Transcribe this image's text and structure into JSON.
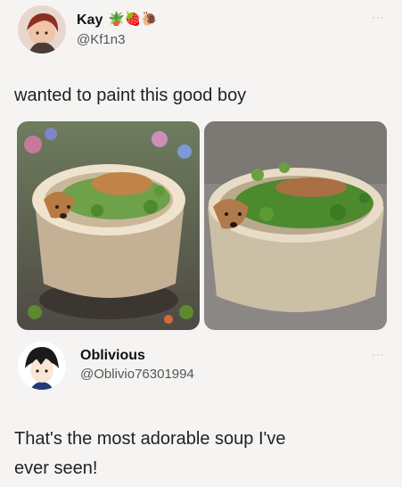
{
  "post": {
    "display_name": "Kay",
    "name_emojis": "🪴🍓🐌",
    "handle": "@Kf1n3",
    "more_label": "···",
    "text": "wanted to paint this good boy",
    "images": [
      {
        "icon": "dog-painting-image"
      },
      {
        "icon": "dog-photo-image"
      }
    ]
  },
  "reply": {
    "display_name": "Oblivious",
    "handle": "@Oblivio76301994",
    "more_label": "···",
    "text_line1": "That's the most adorable soup I've",
    "text_line2": "ever seen!"
  },
  "colors": {
    "background": "#f6f4f2",
    "pot": "#e9dcc6",
    "dog": "#b67a43",
    "leaves": "#4d8a2e"
  }
}
